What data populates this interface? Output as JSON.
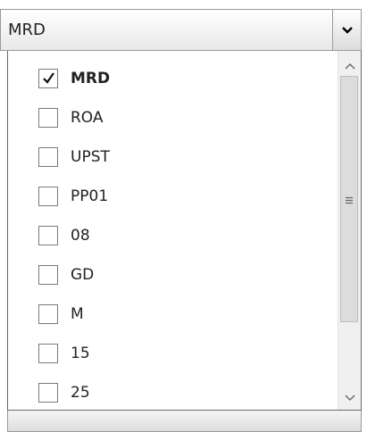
{
  "combo": {
    "selected_text": "MRD",
    "arrow_icon": "chevron-down-icon"
  },
  "items": [
    {
      "label": "MRD",
      "checked": true
    },
    {
      "label": "ROA",
      "checked": false
    },
    {
      "label": "UPST",
      "checked": false
    },
    {
      "label": "PP01",
      "checked": false
    },
    {
      "label": "08",
      "checked": false
    },
    {
      "label": "GD",
      "checked": false
    },
    {
      "label": "M",
      "checked": false
    },
    {
      "label": "15",
      "checked": false
    },
    {
      "label": "25",
      "checked": false
    }
  ],
  "scrollbar": {
    "up_icon": "chevron-up-icon",
    "down_icon": "chevron-down-icon",
    "grip_icon": "grip-icon"
  }
}
